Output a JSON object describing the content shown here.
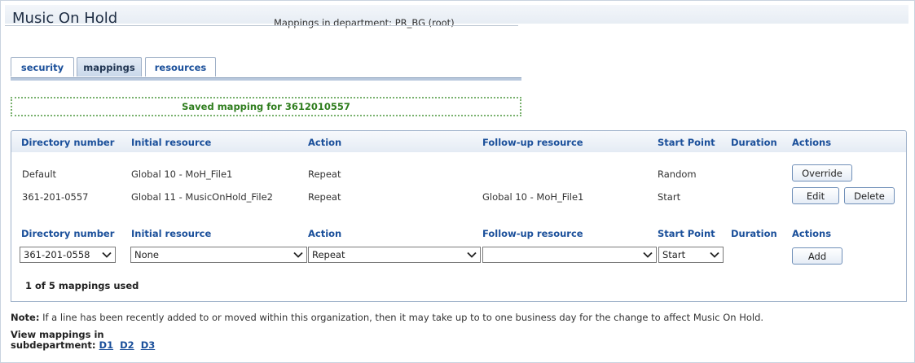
{
  "app": {
    "title": "Music On Hold"
  },
  "page": {
    "subtitle": "Mappings in department: PR_BG (root)"
  },
  "tabs": [
    {
      "label": "security",
      "active": false
    },
    {
      "label": "mappings",
      "active": true
    },
    {
      "label": "resources",
      "active": false
    }
  ],
  "message": "Saved mapping for 3612010557",
  "columns": [
    "Directory number",
    "Initial resource",
    "Action",
    "Follow-up resource",
    "Start Point",
    "Duration",
    "Actions"
  ],
  "rows": [
    {
      "directory": "Default",
      "initial": "Global 10 - MoH_File1",
      "action": "Repeat",
      "followup": "",
      "start": "Random",
      "duration": "",
      "buttons": [
        "Override"
      ]
    },
    {
      "directory": "361-201-0557",
      "initial": "Global 11 - MusicOnHold_File2",
      "action": "Repeat",
      "followup": "Global 10 - MoH_File1",
      "start": "Start",
      "duration": "",
      "buttons": [
        "Edit",
        "Delete"
      ]
    }
  ],
  "add_form": {
    "directory": "361-201-0558",
    "initial": "None",
    "action": "Repeat",
    "followup": "",
    "start": "Start",
    "add_label": "Add"
  },
  "usage": "1 of 5 mappings used",
  "note": {
    "label": "Note:",
    "text": "If a line has been recently added to or moved within this organization, then it may take up to to one business day for the change to affect Music On Hold."
  },
  "subdepartments": {
    "label_line1": "View mappings in",
    "label_line2": "subdepartment:",
    "links": [
      "D1",
      "D2",
      "D3"
    ]
  },
  "colors": {
    "accent": "#1a4f9a",
    "success": "#2e7d1d"
  },
  "icons": {
    "select_arrow": "chevron-down-icon"
  }
}
